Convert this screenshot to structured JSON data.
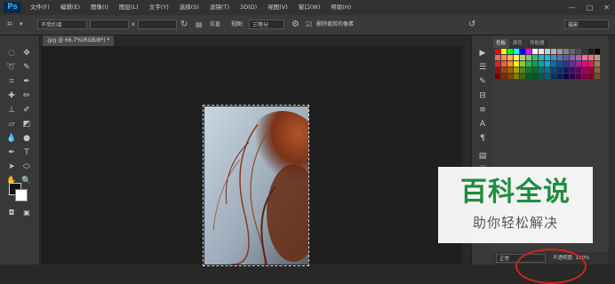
{
  "app": {
    "logo": "Ps"
  },
  "menu": [
    "文件(F)",
    "编辑(E)",
    "图像(I)",
    "图层(L)",
    "文字(Y)",
    "选择(S)",
    "滤镜(T)",
    "3D(D)",
    "视图(V)",
    "窗口(W)",
    "帮助(H)"
  ],
  "window_controls": {
    "minimize": "—",
    "maximize": "□",
    "close": "✕"
  },
  "options": {
    "ratio_select": "不受约束",
    "x_separator": "x",
    "straighten_label": "拉直",
    "view_label": "视图:",
    "view_select": "三等分",
    "delete_cropped_label": "删除裁剪的像素",
    "workspace": "摄影"
  },
  "document": {
    "tab_title": ".jpg @ 66.7%(RGB/8*) *"
  },
  "panel": {
    "tabs": [
      "色板",
      "颜色",
      "导航器"
    ]
  },
  "swatches": [
    "#ff0000",
    "#ffff00",
    "#00ff00",
    "#00ffff",
    "#0000ff",
    "#ff00ff",
    "#ffffff",
    "#e6e6e6",
    "#cccccc",
    "#b3b3b3",
    "#999999",
    "#808080",
    "#666666",
    "#4d4d4d",
    "#333333",
    "#1a1a1a",
    "#000000",
    "#f26c4f",
    "#f68e55",
    "#fbaf5c",
    "#fff467",
    "#acd372",
    "#7cc576",
    "#3bb878",
    "#1abbb4",
    "#00bff3",
    "#438ccb",
    "#5574b9",
    "#605ca8",
    "#855fa8",
    "#a763a8",
    "#f06ea9",
    "#f26d7d",
    "#c69c6e",
    "#ed1c24",
    "#f26522",
    "#f7941d",
    "#fff200",
    "#8dc73f",
    "#39b54a",
    "#00a651",
    "#00a99d",
    "#00aeef",
    "#0072bc",
    "#0054a6",
    "#2e3192",
    "#662d91",
    "#92278f",
    "#ec008c",
    "#ed145b",
    "#a67c52",
    "#9e0b0f",
    "#a0410d",
    "#a36209",
    "#aba000",
    "#598527",
    "#1a7b30",
    "#007236",
    "#00746b",
    "#0076a3",
    "#004b80",
    "#003471",
    "#1b1464",
    "#440e62",
    "#630460",
    "#9e005d",
    "#9e0039",
    "#8c6239",
    "#790000",
    "#7b2e00",
    "#7d4900",
    "#827b00",
    "#406618",
    "#005e20",
    "#005826",
    "#005952",
    "#005b7f",
    "#003663",
    "#002157",
    "#0d004c",
    "#32004b",
    "#4b0049",
    "#7b0046",
    "#7a0026",
    "#754c24"
  ],
  "layers": {
    "blend_mode": "正常",
    "opacity_label": "不透明度: 100%"
  },
  "watermark": {
    "title": "百科全说",
    "subtitle": "助你轻松解决"
  },
  "colors": {
    "accent_green": "#1e8e3e",
    "annotation_red": "#d0261b"
  }
}
